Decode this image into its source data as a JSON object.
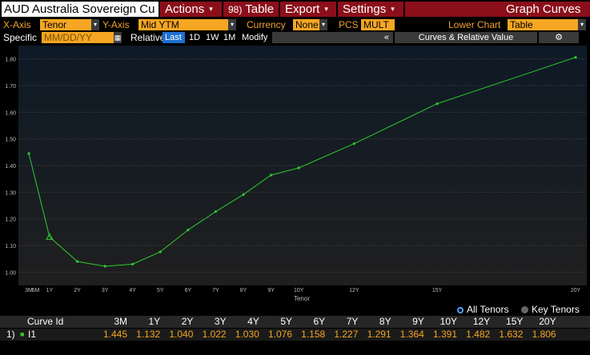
{
  "toolbar": {
    "security_title": "AUD Australia Sovereign Cu",
    "actions_label": "Actions",
    "table_label": "Table",
    "table_key": "98)",
    "export_label": "Export",
    "settings_label": "Settings",
    "graph_curves_label": "Graph Curves",
    "arrow": "▾"
  },
  "settings_row": {
    "x_axis_label": "X-Axis",
    "x_axis_value": "Tenor",
    "y_axis_label": "Y-Axis",
    "y_axis_value": "Mid YTM",
    "currency_label": "Currency",
    "currency_value": "None",
    "pcs_label": "PCS",
    "pcs_value": "MULT",
    "lower_chart_label": "Lower Chart",
    "lower_chart_value": "Table"
  },
  "date_row": {
    "specific_label": "Specific",
    "date_placeholder": "MM/DD/YY",
    "relative_label": "Relative",
    "periods": [
      "Last",
      "1D",
      "1W",
      "1M"
    ],
    "modify_label": "Modify",
    "collapse_label": "«",
    "panel_label": "Curves & Relative Value",
    "gear_label": "⚙"
  },
  "chart_data": {
    "type": "line",
    "x": [
      "3M",
      "6M",
      "1Y",
      "2Y",
      "3Y",
      "4Y",
      "5Y",
      "6Y",
      "7Y",
      "8Y",
      "9Y",
      "10Y",
      "12Y",
      "15Y",
      "20Y"
    ],
    "x_ticks": [
      "3M",
      "6M",
      "1Y",
      "2Y",
      "3Y",
      "4Y",
      "5Y",
      "6Y",
      "7Y",
      "8Y",
      "9Y",
      "10Y",
      "12Y",
      "15Y",
      "20Y"
    ],
    "xlabel": "Tenor",
    "ylabel": "",
    "ylim": [
      0.95,
      1.85
    ],
    "y_ticks": [
      "1.00",
      "1.10",
      "1.20",
      "1.30",
      "1.40",
      "1.50",
      "1.60",
      "1.70",
      "1.80"
    ],
    "grid": true,
    "series": [
      {
        "points": [
          {
            "x": "3M",
            "y": 1.445
          },
          {
            "x": "1Y",
            "y": 1.132
          },
          {
            "x": "2Y",
            "y": 1.04
          },
          {
            "x": "3Y",
            "y": 1.022
          },
          {
            "x": "4Y",
            "y": 1.03
          },
          {
            "x": "5Y",
            "y": 1.076
          },
          {
            "x": "6Y",
            "y": 1.158
          },
          {
            "x": "7Y",
            "y": 1.227
          },
          {
            "x": "8Y",
            "y": 1.291
          },
          {
            "x": "9Y",
            "y": 1.364
          },
          {
            "x": "10Y",
            "y": 1.391
          },
          {
            "x": "12Y",
            "y": 1.482
          },
          {
            "x": "15Y",
            "y": 1.632
          },
          {
            "x": "20Y",
            "y": 1.806
          }
        ],
        "color": "#2ecc2e",
        "marker_on": "1Y"
      }
    ]
  },
  "bottom": {
    "all_tenors_label": "All Tenors",
    "key_tenors_label": "Key Tenors",
    "table": {
      "id_header": "Curve Id",
      "columns": [
        "3M",
        "1Y",
        "2Y",
        "3Y",
        "4Y",
        "5Y",
        "6Y",
        "7Y",
        "8Y",
        "9Y",
        "10Y",
        "12Y",
        "15Y",
        "20Y"
      ],
      "rows": [
        {
          "index": "1)",
          "curve_id": "I1",
          "values": [
            "1.445",
            "1.132",
            "1.040",
            "1.022",
            "1.030",
            "1.076",
            "1.158",
            "1.227",
            "1.291",
            "1.364",
            "1.391",
            "1.482",
            "1.632",
            "1.806"
          ]
        }
      ]
    }
  },
  "colors": {
    "menu_red": "#8b0f1a",
    "field_orange": "#f5a623",
    "label_orange": "#f0a030",
    "series_green": "#2ecc2e",
    "selected_blue": "#1d6fd1"
  }
}
